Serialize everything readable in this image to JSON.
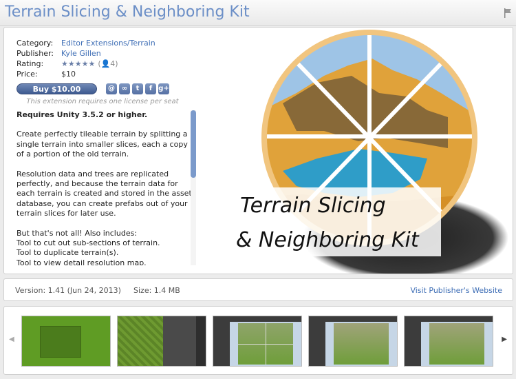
{
  "header": {
    "title": "Terrain Slicing & Neighboring Kit"
  },
  "info": {
    "category_label": "Category:",
    "category_value": "Editor Extensions/Terrain",
    "publisher_label": "Publisher:",
    "publisher_value": "Kyle Gillen",
    "rating_label": "Rating:",
    "rating_stars": "★★★★★",
    "rating_count": "(👤4)",
    "price_label": "Price:",
    "price_value": "$10"
  },
  "buy_button": "Buy $10.00",
  "share": [
    "@",
    "∞",
    "t",
    "f",
    "g+"
  ],
  "share_icons": [
    "unity-community-icon",
    "link-icon",
    "twitter-icon",
    "facebook-icon",
    "google-plus-icon"
  ],
  "license_note": "This extension requires one license per seat",
  "description": {
    "requirement": "Requires Unity 3.5.2 or higher.",
    "p1": "Create perfectly tileable terrain by splitting a single terrain into smaller slices, each a copy of a portion of the old terrain.",
    "p2": "Resolution data and trees are replicated perfectly, and because the terrain data for each terrain is created and stored in the asset database, you can create prefabs out of your terrain slices for later use.",
    "p3_lines": [
      "But that's not all! Also includes:",
      "Tool to cut out sub-sections of terrain.",
      "Tool to duplicate terrain(s).",
      "Tool to view detail resolution map."
    ]
  },
  "hero": {
    "line1": "Terrain Slicing",
    "line2": "& Neighboring Kit"
  },
  "version_bar": {
    "version": "Version: 1.41 (Jun 24, 2013)",
    "size": "Size: 1.4 MB",
    "publisher_link": "Visit Publisher's Website"
  },
  "gallery": {
    "prev": "◀",
    "next": "▶"
  },
  "colors": {
    "title": "#6c8fc7",
    "link": "#3d6db5",
    "button": "#4a659b"
  }
}
